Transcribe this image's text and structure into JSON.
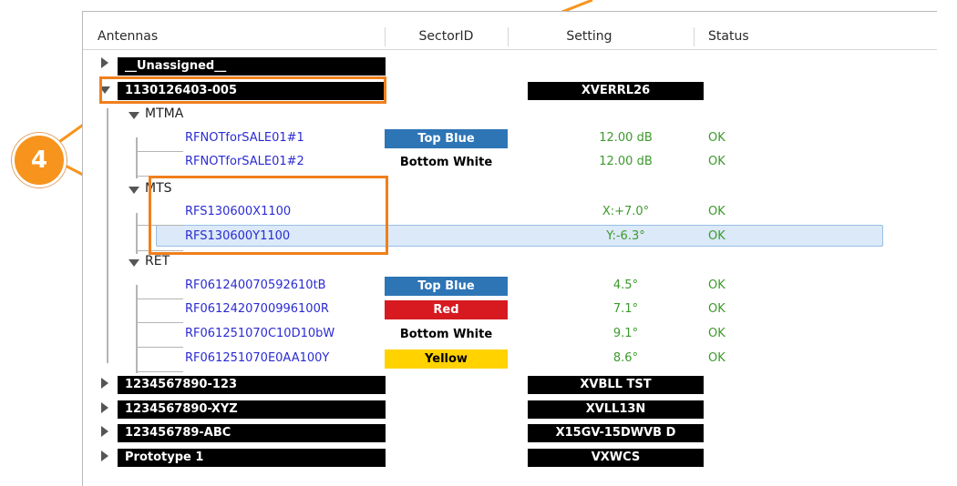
{
  "columns": {
    "antennas": "Antennas",
    "sector": "SectorID",
    "setting": "Setting",
    "status": "Status"
  },
  "unassigned": "__Unassigned__",
  "selected_group": {
    "name": "1130126403-005",
    "setting": "XVERRL26"
  },
  "groups": [
    {
      "name": "MTMA",
      "items": [
        {
          "name": "RFNOTforSALE01#1",
          "sector": "Top Blue",
          "setting": "12.00 dB",
          "status": "OK"
        },
        {
          "name": "RFNOTforSALE01#2",
          "sector": "Bottom White",
          "setting": "12.00 dB",
          "status": "OK"
        }
      ]
    },
    {
      "name": "MTS",
      "items": [
        {
          "name": "RFS130600X1100",
          "sector": "",
          "setting": "X:+7.0°",
          "status": "OK"
        },
        {
          "name": "RFS130600Y1100",
          "sector": "",
          "setting": "Y:-6.3°",
          "status": "OK"
        }
      ]
    },
    {
      "name": "RET",
      "items": [
        {
          "name": "RF061240070592610tB",
          "sector": "Top Blue",
          "setting": "4.5°",
          "status": "OK"
        },
        {
          "name": "RF0612420700996100R",
          "sector": "Red",
          "setting": "7.1°",
          "status": "OK"
        },
        {
          "name": "RF061251070C10D10bW",
          "sector": "Bottom White",
          "setting": "9.1°",
          "status": "OK"
        },
        {
          "name": "RF061251070E0AA100Y",
          "sector": "Yellow",
          "setting": "8.6°",
          "status": "OK"
        }
      ]
    }
  ],
  "others": [
    {
      "name": "1234567890-123",
      "setting": "XVBLL TST"
    },
    {
      "name": "1234567890-XYZ",
      "setting": "XVLL13N"
    },
    {
      "name": "123456789-ABC",
      "setting": "X15GV-15DWVB D"
    },
    {
      "name": "Prototype 1",
      "setting": "VXWCS"
    }
  ],
  "callout_number": "4",
  "colors": {
    "top_blue": "#2e75b6",
    "red": "#d71920",
    "yellow": "#ffd200",
    "bottom_white": "#ffffff",
    "highlight": "#f07f1c"
  }
}
